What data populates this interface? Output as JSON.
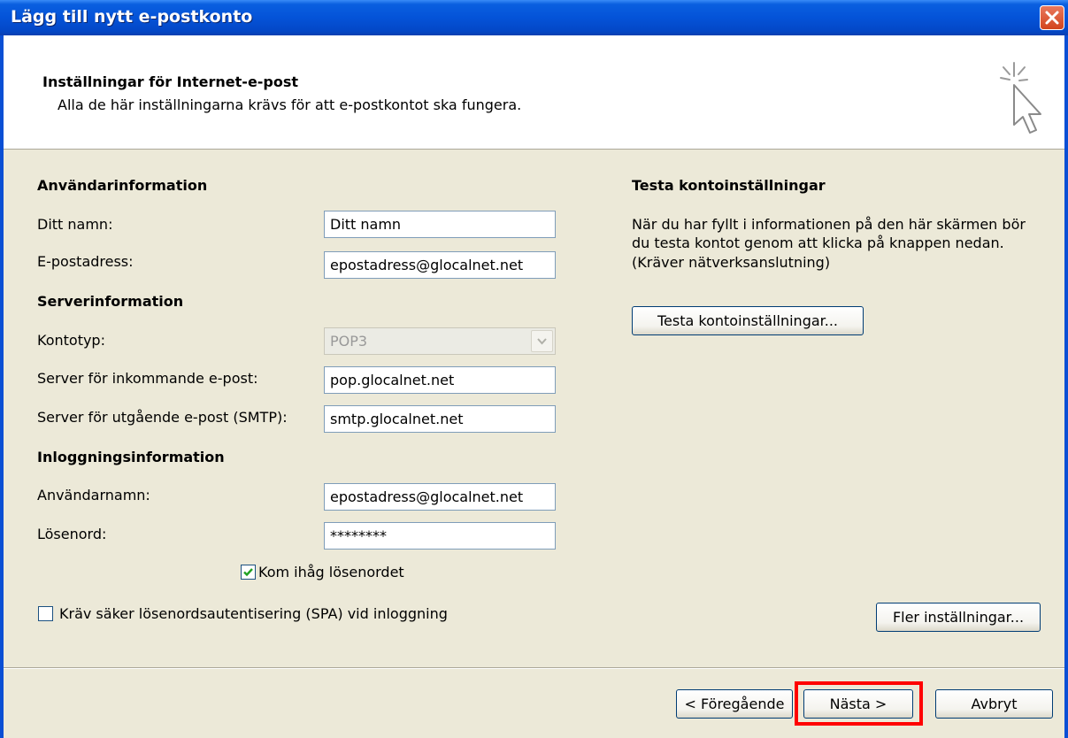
{
  "window": {
    "title": "Lägg till nytt e-postkonto"
  },
  "header": {
    "title": "Inställningar för Internet-e-post",
    "subtitle": "Alla de här inställningarna krävs för att e-postkontot ska fungera."
  },
  "user_info": {
    "heading": "Användarinformation",
    "name_label": "Ditt namn:",
    "name_value": "Ditt namn",
    "email_label": "E-postadress:",
    "email_value": "epostadress@glocalnet.net"
  },
  "server_info": {
    "heading": "Serverinformation",
    "account_type_label": "Kontotyp:",
    "account_type_value": "POP3",
    "incoming_label": "Server för inkommande e-post:",
    "incoming_value": "pop.glocalnet.net",
    "outgoing_label": "Server för utgående e-post (SMTP):",
    "outgoing_value": "smtp.glocalnet.net"
  },
  "login_info": {
    "heading": "Inloggningsinformation",
    "username_label": "Användarnamn:",
    "username_value": "epostadress@glocalnet.net",
    "password_label": "Lösenord:",
    "password_value": "********",
    "remember_label": "Kom ihåg lösenordet",
    "remember_checked": true,
    "spa_label": "Kräv säker lösenordsautentisering (SPA) vid inloggning",
    "spa_checked": false
  },
  "test": {
    "heading": "Testa kontoinställningar",
    "line1": "När du har fyllt i informationen på den här skärmen bör",
    "line2": "du testa kontot genom att klicka på knappen nedan.",
    "line3": "(Kräver nätverksanslutning)",
    "button": "Testa kontoinställningar..."
  },
  "buttons": {
    "more_settings": "Fler inställningar...",
    "back": "< Föregående",
    "next": "Nästa >",
    "cancel": "Avbryt"
  },
  "colors": {
    "titlebar": "#0453d8",
    "dialog_bg": "#ece9d8",
    "highlight": "#ff0000",
    "checkmark": "#21a121"
  },
  "icons": {
    "close": "close-icon",
    "wizard": "cursor-sparkle-icon",
    "dropdown": "chevron-down-icon",
    "check": "checkmark-icon"
  }
}
